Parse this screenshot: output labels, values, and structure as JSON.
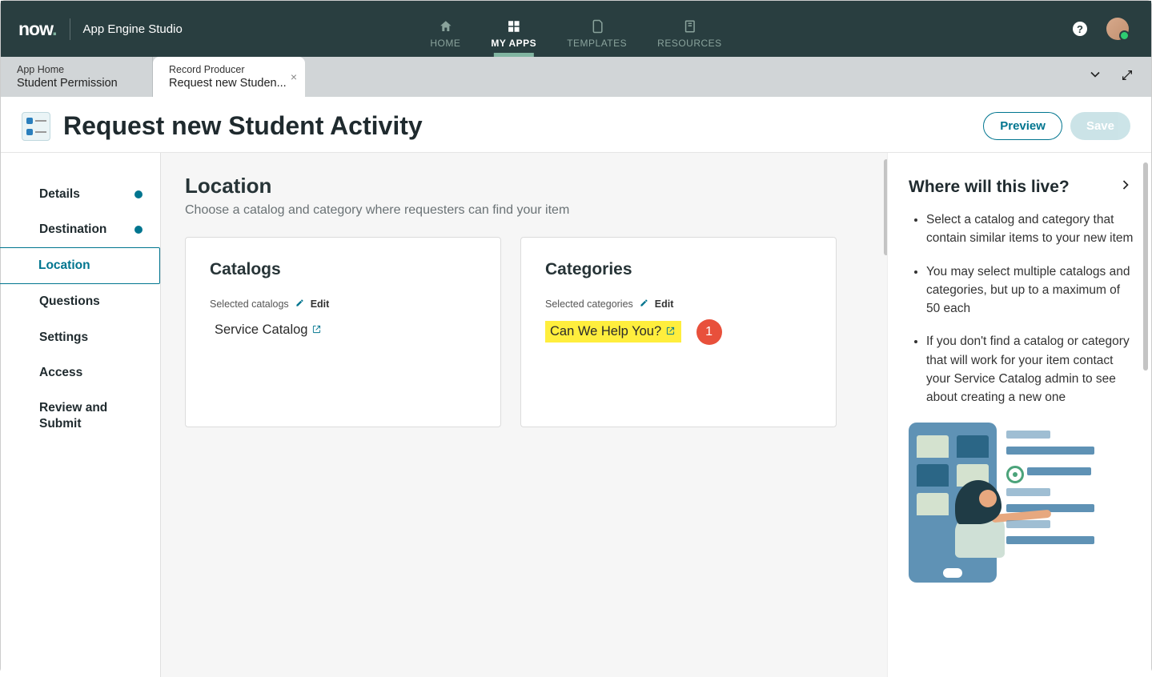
{
  "brand": {
    "logo_text": "now",
    "product": "App Engine Studio"
  },
  "topnav": {
    "home": "HOME",
    "myapps": "MY APPS",
    "templates": "TEMPLATES",
    "resources": "RESOURCES",
    "help_char": "?"
  },
  "tabs": {
    "tab0": {
      "line1": "App Home",
      "line2": "Student Permission"
    },
    "tab1": {
      "line1": "Record Producer",
      "line2": "Request new Studen...",
      "close": "×"
    }
  },
  "header": {
    "title": "Request new Student Activity",
    "preview": "Preview",
    "save": "Save"
  },
  "sidebar": {
    "details": "Details",
    "destination": "Destination",
    "location": "Location",
    "questions": "Questions",
    "settings": "Settings",
    "access": "Access",
    "review": "Review and Submit"
  },
  "content": {
    "title": "Location",
    "subtitle": "Choose a catalog and category where requesters can find your item",
    "catalogs_card": {
      "title": "Catalogs",
      "sub_label": "Selected catalogs",
      "edit": "Edit",
      "item": "Service Catalog"
    },
    "categories_card": {
      "title": "Categories",
      "sub_label": "Selected categories",
      "edit": "Edit",
      "item": "Can We Help You?",
      "badge": "1"
    }
  },
  "right": {
    "title": "Where will this live?",
    "bullets": {
      "b0": "Select a catalog and category that contain similar items to your new item",
      "b1": "You may select multiple catalogs and categories, but up to a maximum of 50 each",
      "b2": "If you don't find a catalog or category that will work for your item contact your Service Catalog admin to see about creating a new one"
    }
  }
}
